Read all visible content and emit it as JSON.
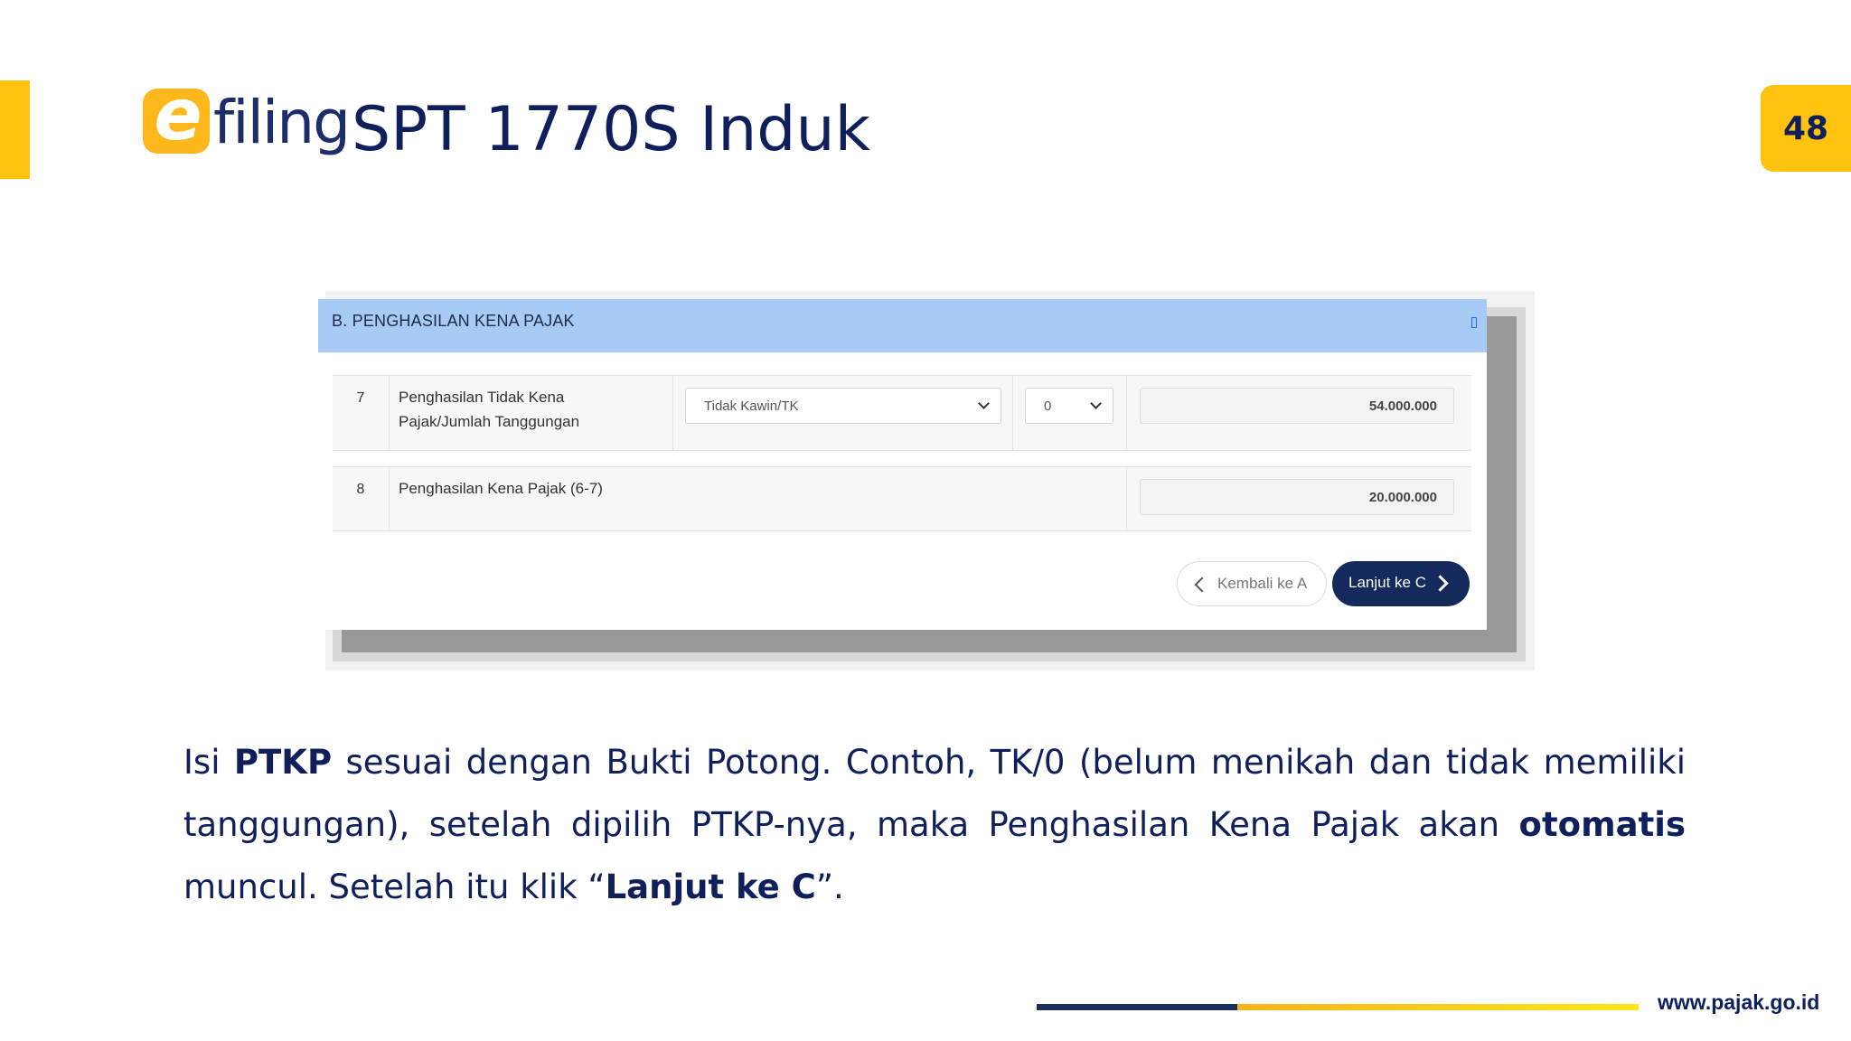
{
  "slide": {
    "logo_letter": "e",
    "logo_word": "filing",
    "title": "SPT 1770S Induk",
    "page_number": "48",
    "footer_url": "www.pajak.go.id"
  },
  "screenshot": {
    "section_title": "B. PENGHASILAN KENA PAJAK",
    "rows": [
      {
        "number": "7",
        "label_line1": "Penghasilan Tidak Kena",
        "label_line2": "Pajak/Jumlah Tanggungan",
        "status_select": "Tidak Kawin/TK",
        "dependents_select": "0",
        "amount": "54.000.000"
      },
      {
        "number": "8",
        "label": "Penghasilan Kena Pajak (6-7)",
        "amount": "20.000.000"
      }
    ],
    "back_button": "Kembali ke A",
    "next_button": "Lanjut ke C"
  },
  "instruction": {
    "t1": "Isi ",
    "b1": "PTKP",
    "t2": " sesuai dengan Bukti Potong. Contoh, TK/0 (belum menikah dan tidak memiliki tanggungan), setelah dipilih PTKP-nya, maka Penghasilan Kena Pajak akan ",
    "b2": "otomatis",
    "t3": " muncul. Setelah itu klik “",
    "b3": "Lanjut ke C",
    "t4": "”."
  },
  "colors": {
    "accent_yellow": "#ffc20e",
    "navy": "#0f1f5c",
    "header_blue": "#a8cbf5",
    "button_navy": "#152a5c"
  }
}
